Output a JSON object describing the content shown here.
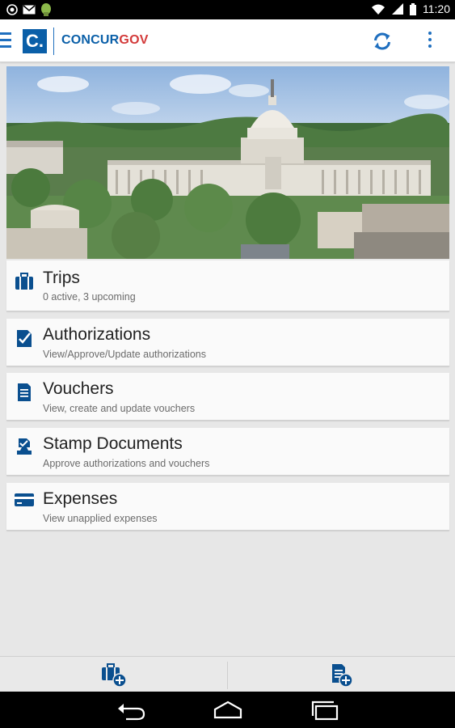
{
  "status_bar": {
    "time": "11:20",
    "icons": [
      "whatsapp-icon",
      "gmail-icon",
      "android-icon",
      "wifi-icon",
      "signal-icon",
      "battery-icon"
    ]
  },
  "app_bar": {
    "logo_letter": "C.",
    "brand_part1": "CONCUR",
    "brand_part2": "GOV",
    "menu_icon": "menu-icon",
    "sync_icon": "sync-icon",
    "overflow_icon": "more-vertical-icon",
    "colors": {
      "brand_blue": "#0a5fa8",
      "brand_red": "#d33a3a",
      "accent": "#1f6fbf"
    }
  },
  "menu_items": [
    {
      "title": "Trips",
      "subtitle": "0 active, 3 upcoming",
      "icon": "briefcase-icon"
    },
    {
      "title": "Authorizations",
      "subtitle": "View/Approve/Update authorizations",
      "icon": "document-check-icon"
    },
    {
      "title": "Vouchers",
      "subtitle": "View, create and update vouchers",
      "icon": "document-icon"
    },
    {
      "title": "Stamp Documents",
      "subtitle": "Approve authorizations and vouchers",
      "icon": "stamp-icon"
    },
    {
      "title": "Expenses",
      "subtitle": "View unapplied expenses",
      "icon": "credit-card-icon"
    }
  ],
  "bottom_actions": [
    {
      "icon": "add-trip-icon"
    },
    {
      "icon": "add-document-icon"
    }
  ],
  "nav_bar": [
    "back-icon",
    "home-icon",
    "recent-apps-icon"
  ]
}
